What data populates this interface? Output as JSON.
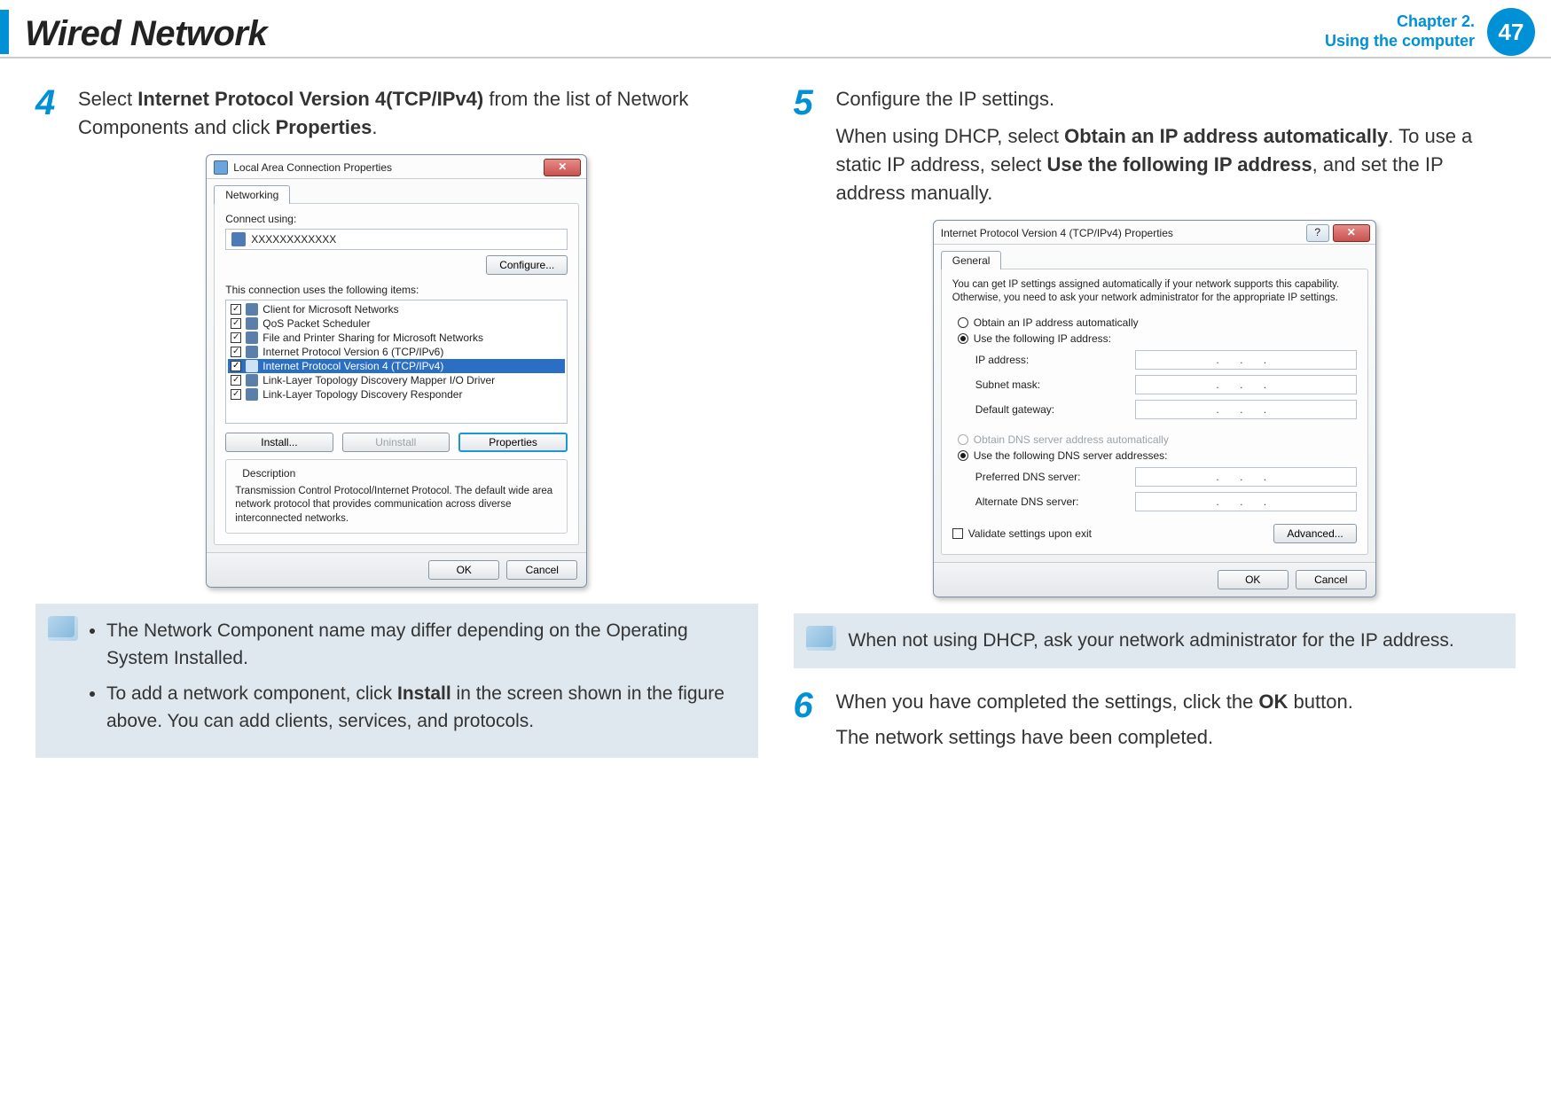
{
  "header": {
    "title": "Wired Network",
    "chapter_line1": "Chapter 2.",
    "chapter_line2": "Using the computer",
    "page_number": "47"
  },
  "step4": {
    "num": "4",
    "text_prefix": "Select ",
    "bold1": "Internet Protocol Version 4(TCP/IPv4)",
    "text_mid": " from the list of Network Components and click ",
    "bold2": "Properties",
    "text_suffix": "."
  },
  "lan_dialog": {
    "title": "Local Area Connection Properties",
    "tab": "Networking",
    "connect_using_label": "Connect using:",
    "adapter": "XXXXXXXXXXXX",
    "configure_btn": "Configure...",
    "items_label": "This connection uses the following items:",
    "items": [
      "Client for Microsoft Networks",
      "QoS Packet Scheduler",
      "File and Printer Sharing for Microsoft Networks",
      "Internet Protocol Version 6 (TCP/IPv6)",
      "Internet Protocol Version 4 (TCP/IPv4)",
      "Link-Layer Topology Discovery Mapper I/O Driver",
      "Link-Layer Topology Discovery Responder"
    ],
    "install_btn": "Install...",
    "uninstall_btn": "Uninstall",
    "properties_btn": "Properties",
    "desc_group": "Description",
    "desc_text": "Transmission Control Protocol/Internet Protocol. The default wide area network protocol that provides communication across diverse interconnected networks.",
    "ok_btn": "OK",
    "cancel_btn": "Cancel"
  },
  "note_left": {
    "bullet1": "The Network Component name may differ depending on the Operating System Installed.",
    "bullet2_prefix": "To add a network component, click ",
    "bullet2_bold": "Install",
    "bullet2_suffix": " in the screen shown in the figure above. You can add clients, services, and protocols."
  },
  "step5": {
    "num": "5",
    "line1": "Configure the IP settings.",
    "line2_prefix": "When using DHCP, select ",
    "line2_bold1": "Obtain an IP address automatically",
    "line2_mid": ". To use a static IP address, select ",
    "line2_bold2": "Use the following IP address",
    "line2_suffix": ", and set the IP address manually."
  },
  "ip_dialog": {
    "title": "Internet Protocol Version 4 (TCP/IPv4) Properties",
    "tab": "General",
    "intro": "You can get IP settings assigned automatically if your network supports this capability. Otherwise, you need to ask your network administrator for the appropriate IP settings.",
    "radio_auto_ip": "Obtain an IP address automatically",
    "radio_static_ip": "Use the following IP address:",
    "ip_label": "IP address:",
    "subnet_label": "Subnet mask:",
    "gateway_label": "Default gateway:",
    "radio_auto_dns": "Obtain DNS server address automatically",
    "radio_static_dns": "Use the following DNS server addresses:",
    "pref_dns_label": "Preferred DNS server:",
    "alt_dns_label": "Alternate DNS server:",
    "validate_label": "Validate settings upon exit",
    "advanced_btn": "Advanced...",
    "ok_btn": "OK",
    "cancel_btn": "Cancel",
    "ip_placeholder": ".   .   ."
  },
  "note_right": {
    "text": "When not using DHCP, ask your network administrator for the IP address."
  },
  "step6": {
    "num": "6",
    "line1_prefix": "When you have completed the settings, click the ",
    "line1_bold": "OK",
    "line1_suffix": " button.",
    "line2": "The network settings have been completed."
  }
}
